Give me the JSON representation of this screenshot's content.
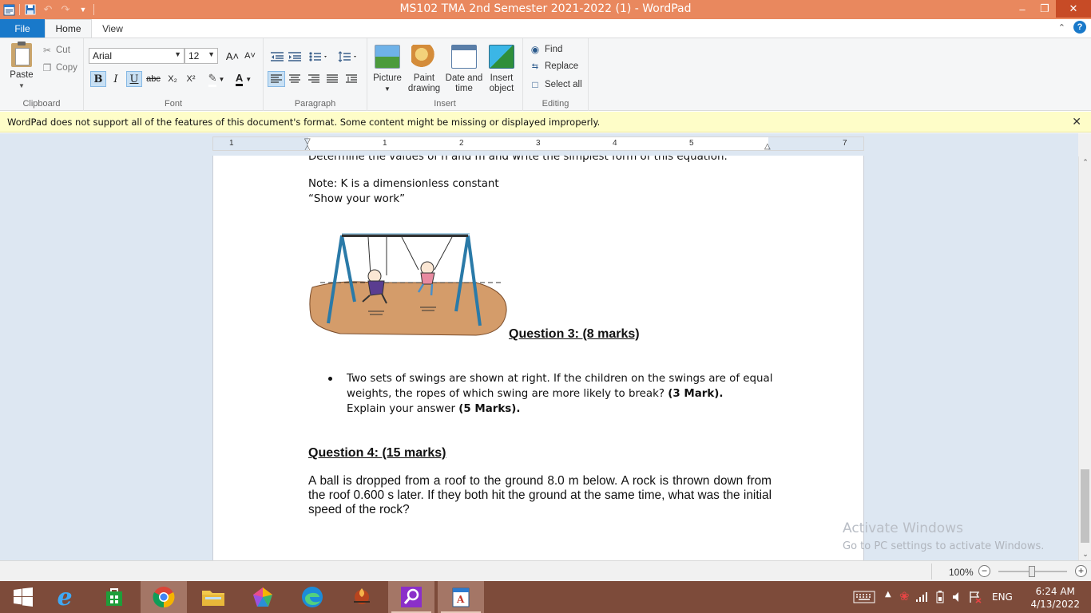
{
  "titlebar": {
    "title": "MS102 TMA 2nd Semester 2021-2022 (1) - WordPad",
    "minimize": "–",
    "restore": "❐",
    "close": "✕"
  },
  "tabs": {
    "file": "File",
    "home": "Home",
    "view": "View",
    "help": "?"
  },
  "ribbon": {
    "clipboard": {
      "label": "Clipboard",
      "paste": "Paste",
      "cut": "Cut",
      "copy": "Copy"
    },
    "font": {
      "label": "Font",
      "family": "Arial",
      "size": "12",
      "grow": "A˄",
      "shrink": "A˅",
      "bold": "B",
      "italic": "I",
      "underline": "U",
      "strike": "abc",
      "subscript": "X₂",
      "superscript": "X²",
      "color": "A"
    },
    "paragraph": {
      "label": "Paragraph"
    },
    "insert": {
      "label": "Insert",
      "picture": "Picture",
      "paint_1": "Paint",
      "paint_2": "drawing",
      "date_1": "Date and",
      "date_2": "time",
      "object_1": "Insert",
      "object_2": "object"
    },
    "editing": {
      "label": "Editing",
      "find": "Find",
      "replace": "Replace",
      "select_all": "Select all"
    }
  },
  "infobar": {
    "message": "WordPad does not support all of the features of this document's format. Some content might be missing or displayed improperly."
  },
  "ruler": {
    "ticks": [
      "1",
      "1",
      "2",
      "3",
      "4",
      "5",
      "7"
    ]
  },
  "document": {
    "cut_line": "Determine  the values of n and m and write the simplest form of this equation.",
    "note": "Note: K is a dimensionless constant",
    "show_work": "“Show your work”",
    "q3_heading": "Question 3: (8 marks)",
    "q3_bullet_1": "Two sets of swings are shown at right. If the children on the swings are of equal weights, the ropes of which swing are more likely to break?",
    "q3_bullet_1_marks": "(3 Mark).",
    "q3_bullet_2": "Explain your answer",
    "q3_bullet_2_marks": "(5 Marks).",
    "q4_heading": "Question 4: (15 marks)",
    "q4_body": "A ball is dropped from a roof to the ground 8.0 m below. A rock is thrown  down from the roof 0.600 s later. If they both hit the ground at the same time, what was the initial speed of the rock?"
  },
  "watermark": {
    "line1": "Activate Windows",
    "line2": "Go to PC settings to activate Windows."
  },
  "statusbar": {
    "zoom": "100%",
    "zoom_level": 1.0
  },
  "taskbar": {
    "language": "ENG",
    "time": "6:24 AM",
    "date": "4/13/2022"
  },
  "colors": {
    "titlebar": "#e9885e",
    "file_tab": "#1979ca",
    "infobar": "#fefdc8",
    "workspace": "#dde7f2",
    "taskbar": "#7d4b3a"
  }
}
